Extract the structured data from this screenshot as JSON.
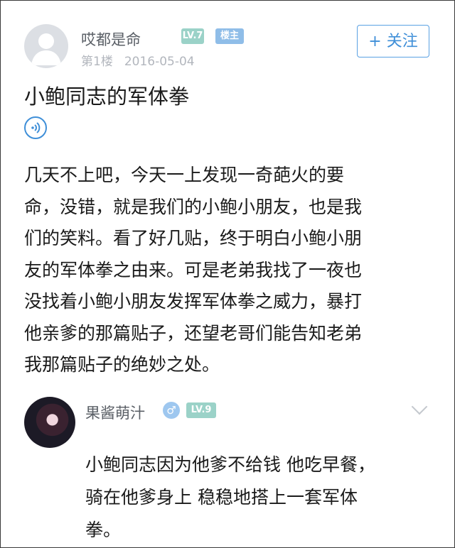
{
  "post": {
    "author": "哎都是命",
    "level": "LV.7",
    "louzhu_badge": "楼主",
    "floor": "第1楼",
    "date": "2016-05-04",
    "follow_button": "+ 关注",
    "title": "小鲍同志的军体拳",
    "voice_icon": "voice-icon",
    "body_lines": [
      "几天不上吧，今天一上发现一奇葩火的要",
      "命，没错，就是我们的小鲍小朋友，也是我",
      "们的笑料。看了好几贴，终于明白小鲍小朋",
      "友的军体拳之由来。可是老弟我找了一夜也",
      "没找着小鲍小朋友发挥军体拳之威力，暴打",
      "他亲爹的那篇贴子，还望老哥们能告知老弟",
      "我那篇贴子的绝妙之处。"
    ]
  },
  "reply": {
    "author": "果酱萌汁",
    "gender_symbol": "♂",
    "level": "LV.9",
    "body_lines": [
      "小鲍同志因为他爹不给钱  他吃早餐，",
      "骑在他爹身上  稳稳地搭上一套军体",
      "拳。"
    ]
  },
  "colors": {
    "accent_blue": "#3f8fd8",
    "level_badge": "#9bd2c8",
    "louzhu_badge": "#8fbde8",
    "meta_gray": "#b2b6bd"
  }
}
